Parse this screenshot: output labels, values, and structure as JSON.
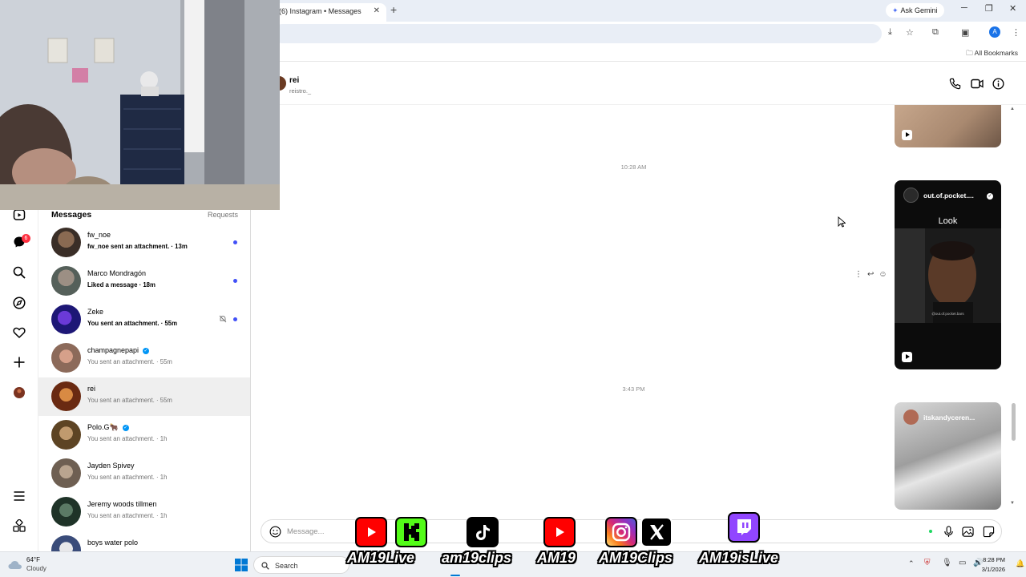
{
  "browser": {
    "tab_title": "(6) Instagram • Messages",
    "tab_close": "✕",
    "new_tab": "+",
    "ask_gemini": "Ask Gemini",
    "profile_initial": "A",
    "all_bookmarks": "All Bookmarks"
  },
  "rail": {
    "notification_count": "6"
  },
  "inbox": {
    "title": "Messages",
    "requests_label": "Requests",
    "conversations": [
      {
        "name": "fw_noe",
        "preview": "fw_noe sent an attachment. · 13m",
        "unread": true,
        "avatar_color": "#5b4a3e"
      },
      {
        "name": "Marco Mondragón",
        "preview": "Liked a message · 18m",
        "unread": true,
        "avatar_color": "#6f7470"
      },
      {
        "name": "Zeke",
        "preview": "You sent an attachment. · 55m",
        "unread": true,
        "muted": true,
        "avatar_color": "#2a1f8f"
      },
      {
        "name": "champagnepapi",
        "preview": "You sent an attachment. · 55m",
        "verified": true,
        "avatar_color": "#a07a6a"
      },
      {
        "name": "rei",
        "preview": "You sent an attachment. · 55m",
        "active": true,
        "avatar_color": "#8a3b1c"
      },
      {
        "name": "Polo.G🐂",
        "preview": "You sent an attachment. · 1h",
        "verified": true,
        "avatar_color": "#7d5a32"
      },
      {
        "name": "Jayden Spivey",
        "preview": "You sent an attachment. · 1h",
        "avatar_color": "#8c7b6b"
      },
      {
        "name": "Jeremy woods tillmen",
        "preview": "You sent an attachment. · 1h",
        "avatar_color": "#2f4a3a"
      },
      {
        "name": "boys water polo",
        "preview": "",
        "avatar_color": "#3a4c7a"
      }
    ]
  },
  "chat": {
    "name": "rei",
    "username": "reistro._",
    "timestamps": [
      "10:28 AM",
      "3:43 PM"
    ],
    "reel_1_user": "out.of.pocket....",
    "reel_1_caption": "Look",
    "reel_1_watermark": "@out.of.pocket.bars",
    "reel_2_user": "itskandyceren...",
    "composer_placeholder": "Message..."
  },
  "stream_overlay": [
    "AM19Live",
    "am19clips",
    "AM19",
    "AM19Clips",
    "AM19isLive"
  ],
  "taskbar": {
    "temperature": "64°F",
    "condition": "Cloudy",
    "search_label": "Search",
    "time": "8:28 PM",
    "date": "3/1/2026"
  },
  "colors": {
    "unread_dot": "#4150f7",
    "verified": "#0095f6",
    "notification_badge": "#ff3040",
    "youtube": "#ff0000",
    "kick": "#53fc18",
    "twitch": "#9146ff"
  }
}
